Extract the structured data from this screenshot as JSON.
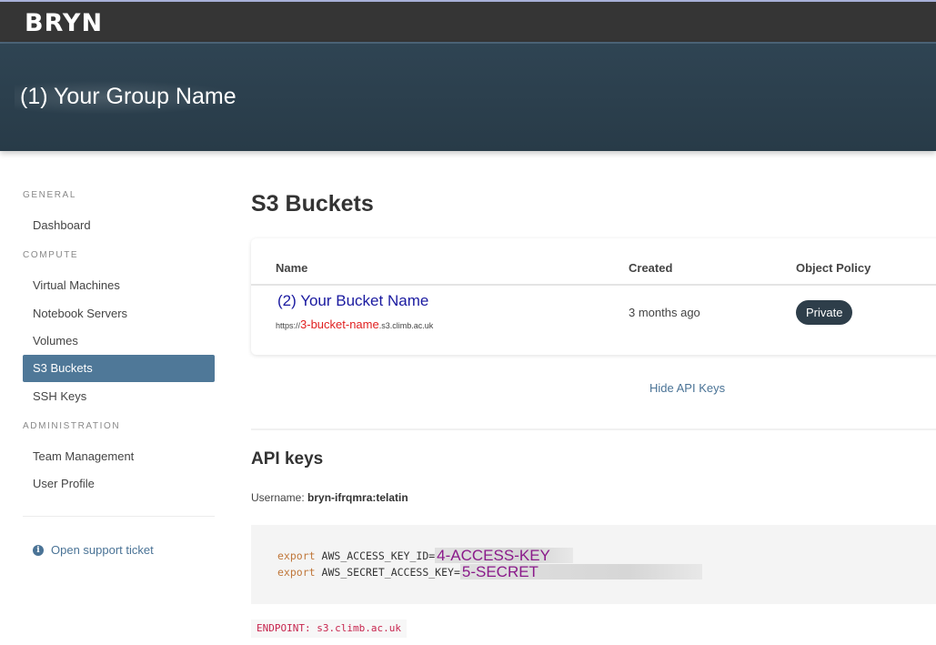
{
  "app": {
    "logo": "BRYN"
  },
  "banner": {
    "group_name": "(1) Your Group Name"
  },
  "sidebar": {
    "sections": [
      {
        "label": "GENERAL",
        "items": [
          {
            "label": "Dashboard",
            "active": false
          }
        ]
      },
      {
        "label": "COMPUTE",
        "items": [
          {
            "label": "Virtual Machines",
            "active": false
          },
          {
            "label": "Notebook Servers",
            "active": false
          },
          {
            "label": "Volumes",
            "active": false
          },
          {
            "label": "S3 Buckets",
            "active": true
          },
          {
            "label": "SSH Keys",
            "active": false
          }
        ]
      },
      {
        "label": "ADMINISTRATION",
        "items": [
          {
            "label": "Team Management",
            "active": false
          },
          {
            "label": "User Profile",
            "active": false
          }
        ]
      }
    ],
    "support_link": {
      "icon": "info-icon",
      "label": "Open support ticket"
    }
  },
  "main": {
    "title": "S3 Buckets",
    "table": {
      "columns": [
        "Name",
        "Created",
        "Object Policy"
      ],
      "rows": [
        {
          "name": "(2) Your Bucket Name",
          "url_prefix": "https://",
          "url_bucket": "3-bucket-name",
          "url_suffix": ".s3.climb.ac.uk",
          "created": "3 months ago",
          "policy": "Private"
        }
      ]
    },
    "hide_keys_label": "Hide API Keys",
    "api_keys": {
      "title": "API keys",
      "username_label": "Username:",
      "username_value": "bryn-ifrqmra:telatin",
      "lines": [
        {
          "keyword": "export",
          "var": "AWS_ACCESS_KEY_ID=",
          "value": "4-ACCESS-KEY"
        },
        {
          "keyword": "export",
          "var": "AWS_SECRET_ACCESS_KEY=",
          "value": "5-SECRET"
        }
      ],
      "endpoint": "ENDPOINT: s3.climb.ac.uk"
    }
  },
  "colors": {
    "topbar": "#353535",
    "banner": "#2c404e",
    "active_nav": "#4f7898",
    "link": "#4a7396",
    "badge": "#2e3e4a",
    "bucket_name": "#1a1aa0",
    "bucket_highlight": "#e02020",
    "secret_text": "#8a1a8a",
    "endpoint": "#c7254e"
  }
}
